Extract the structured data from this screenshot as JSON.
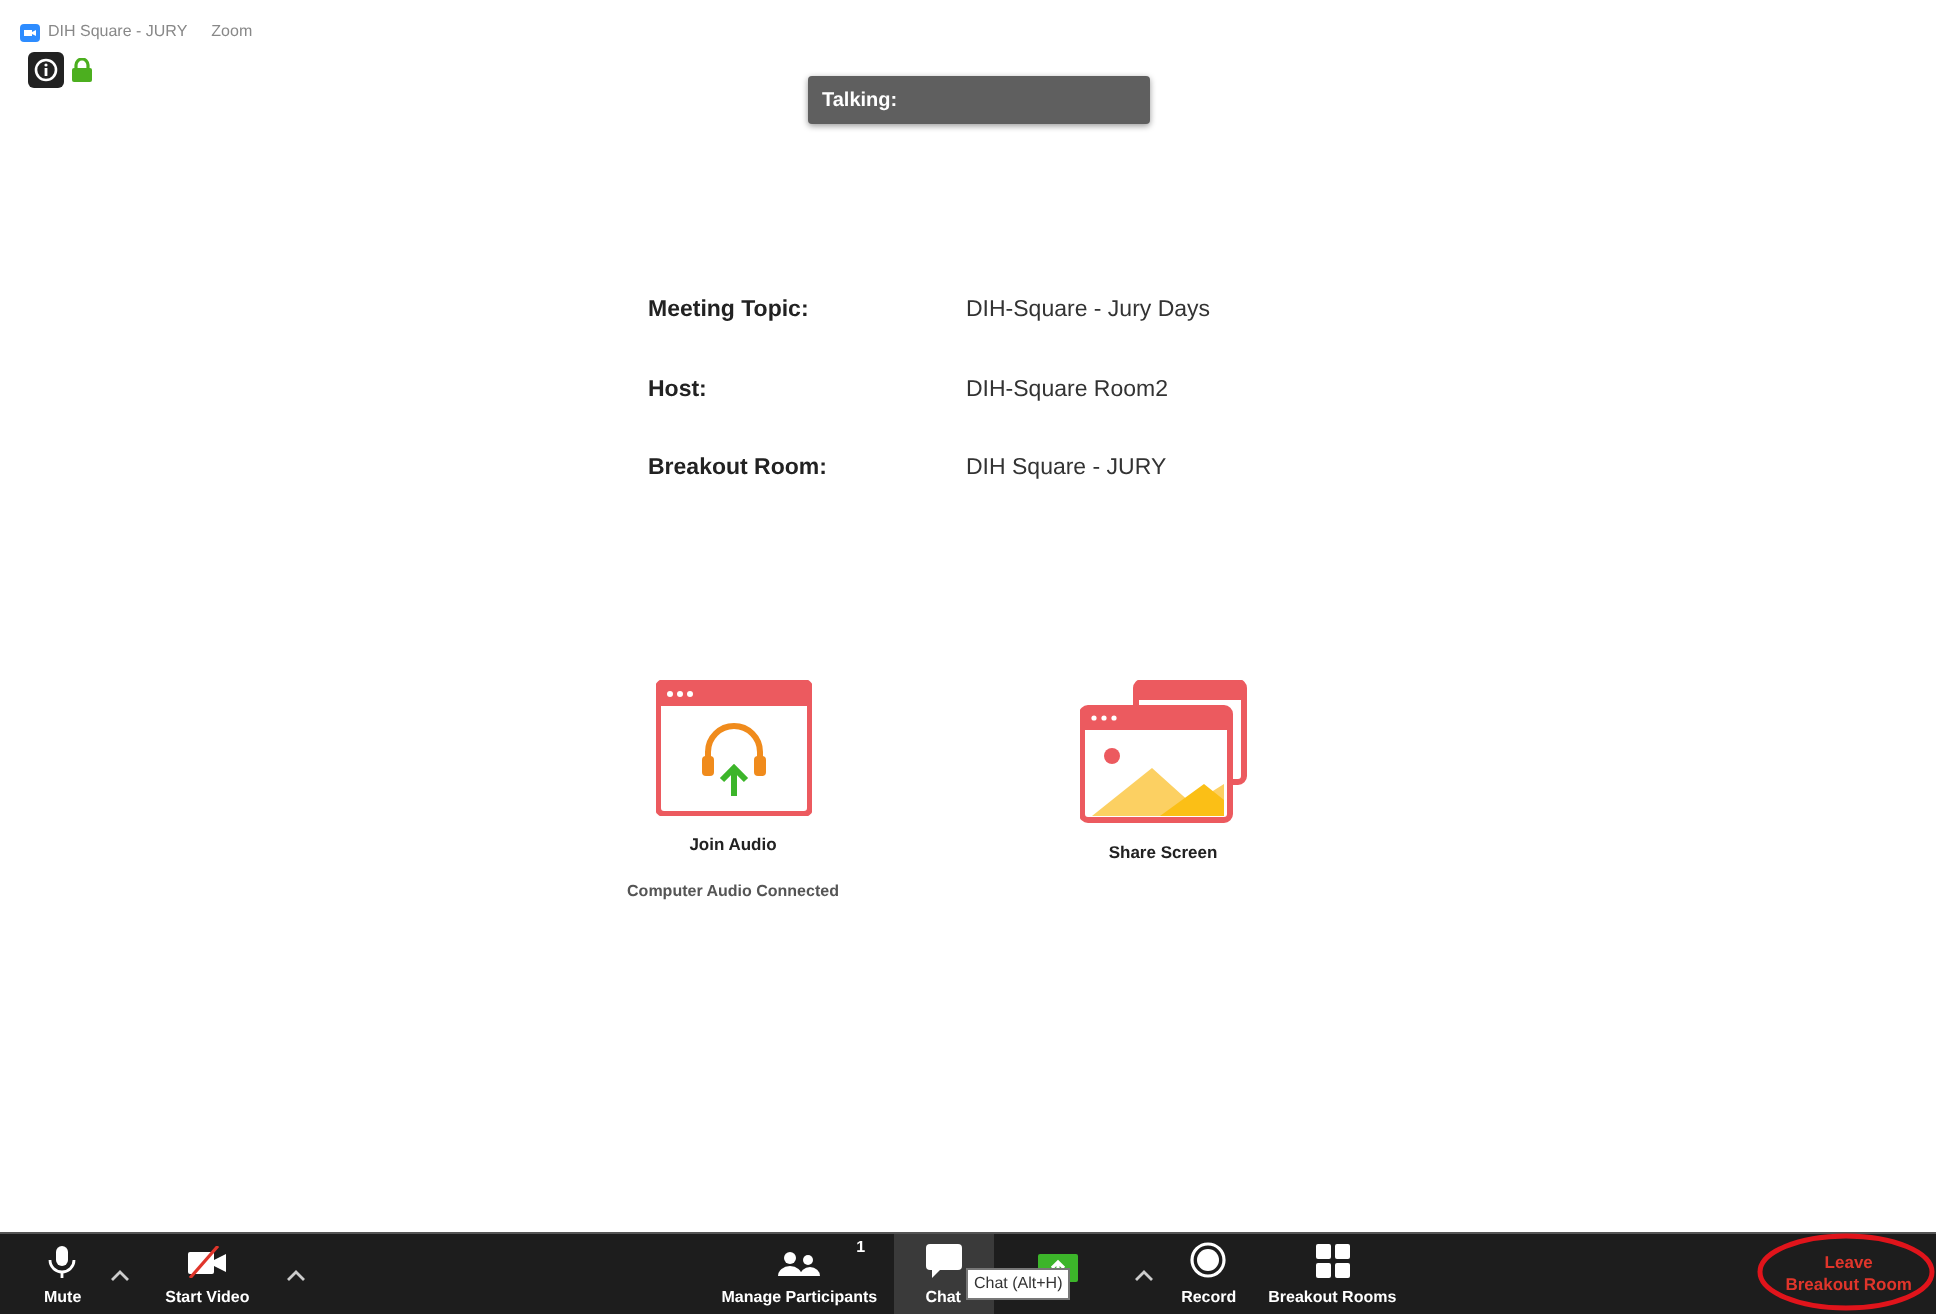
{
  "window": {
    "title": "DIH Square - JURY",
    "app": "Zoom"
  },
  "status": {
    "encrypted": true
  },
  "talking": "Talking:",
  "meeting_info": [
    {
      "label": "Meeting Topic:",
      "value": "DIH-Square  - Jury Days"
    },
    {
      "label": "Host:",
      "value": "DIH-Square Room2"
    },
    {
      "label": "Breakout Room:",
      "value": "DIH Square - JURY"
    }
  ],
  "actions": [
    {
      "kind": "audio",
      "label": "Join Audio",
      "caption": "Computer Audio Connected"
    },
    {
      "kind": "share",
      "label": "Share Screen"
    }
  ],
  "toolbar": {
    "left": [
      {
        "kind": "mic",
        "label": "Mute",
        "selected": false
      },
      {
        "kind": "caret",
        "selected": false
      },
      {
        "kind": "video",
        "label": "Start Video",
        "selected": false
      },
      {
        "kind": "caret",
        "selected": false
      }
    ],
    "center": [
      {
        "kind": "participants",
        "label": "Manage Participants",
        "count": "1",
        "selected": false
      },
      {
        "kind": "chat",
        "label": "Chat",
        "selected": true
      },
      {
        "kind": "share",
        "selected": false
      },
      {
        "kind": "caret",
        "selected": false
      },
      {
        "kind": "record",
        "label": "Record",
        "selected": false
      },
      {
        "kind": "rooms",
        "label": "Breakout Rooms",
        "selected": false
      }
    ],
    "tooltip": "Chat (Alt+H)",
    "leave": {
      "lines": [
        "Leave",
        "Breakout Room"
      ],
      "circled": true
    }
  }
}
